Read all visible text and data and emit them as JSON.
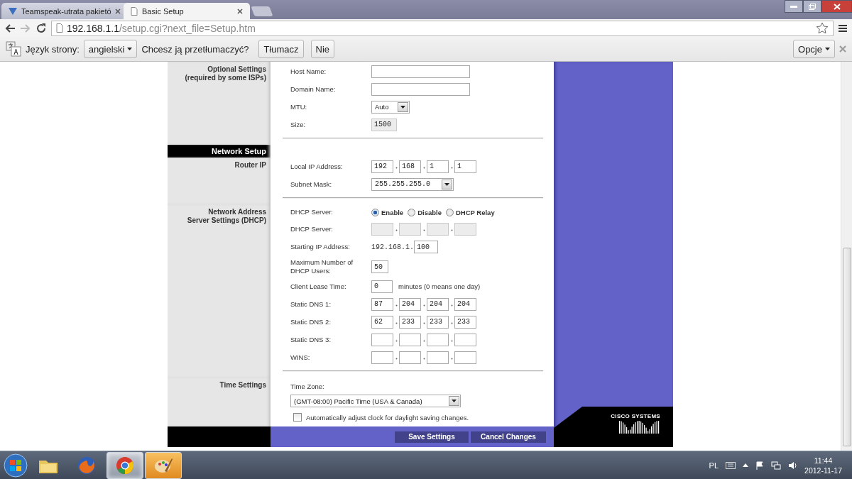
{
  "browser": {
    "tabs": [
      {
        "title": "Teamspeak-utrata pakietó",
        "selected": false
      },
      {
        "title": "Basic Setup",
        "selected": true
      }
    ],
    "address": {
      "host": "192.168.1.1",
      "path": "/setup.cgi?next_file=Setup.htm"
    }
  },
  "translate_bar": {
    "label": "Język strony:",
    "language": "angielski",
    "question": "Chcesz ją przetłumaczyć?",
    "buttons": [
      "Tłumacz",
      "Nie"
    ],
    "options": "Opcje"
  },
  "page": {
    "sections": [
      {
        "kind": "form",
        "heading": [
          "Optional Settings",
          "(required by some ISPs)"
        ],
        "rows": [
          {
            "kind": "text",
            "label": "Host Name:"
          },
          {
            "kind": "text",
            "label": "Domain Name:"
          },
          {
            "kind": "select",
            "label": "MTU:",
            "value": "Auto"
          },
          {
            "kind": "number",
            "label": "Size:",
            "value": "1500",
            "disabled": true
          }
        ]
      },
      {
        "kind": "header",
        "heading": [
          "Network Setup"
        ]
      },
      {
        "kind": "form",
        "heading": [
          "Router IP"
        ],
        "rows": [
          {
            "kind": "ip",
            "label": "Local IP Address:",
            "octets": [
              "192",
              "168",
              "1",
              "1"
            ],
            "disabled": false
          },
          {
            "kind": "select",
            "label": "Subnet Mask:",
            "value": "255.255.255.0"
          }
        ]
      },
      {
        "kind": "form",
        "heading": [
          "Network Address",
          "Server Settings (DHCP)"
        ],
        "rows": [
          {
            "kind": "radio",
            "label": "DHCP Server:",
            "options": [
              {
                "label": "Enable",
                "selected": true
              },
              {
                "label": "Disable",
                "selected": false
              },
              {
                "label": "DHCP Relay",
                "selected": false
              }
            ]
          },
          {
            "kind": "ip",
            "label": "DHCP Server:",
            "disabled": true
          },
          {
            "kind": "prefixed",
            "label": "Starting IP Address:",
            "prefix": "192.168.1.",
            "value": "100"
          },
          {
            "kind": "number",
            "label": "Maximum Number of DHCP Users:",
            "value": "50",
            "disabled": false
          },
          {
            "kind": "number",
            "label": "Client Lease Time:",
            "value": "0",
            "note": "minutes (0 means one day)",
            "disabled": false
          },
          {
            "kind": "ip",
            "label": "Static DNS 1:",
            "octets": [
              "87",
              "204",
              "204",
              "204"
            ],
            "disabled": false
          },
          {
            "kind": "ip",
            "label": "Static DNS 2:",
            "octets": [
              "62",
              "233",
              "233",
              "233"
            ],
            "disabled": false
          },
          {
            "kind": "ip",
            "label": "Static DNS 3:",
            "disabled": false
          },
          {
            "kind": "ip",
            "label": "WINS:",
            "disabled": false
          }
        ]
      },
      {
        "kind": "form",
        "heading": [
          "Time Settings"
        ],
        "rows": [
          {
            "kind": "caption",
            "label": "Time Zone:"
          },
          {
            "kind": "wide_select",
            "value": "(GMT-08:00) Pacific Time (USA & Canada)"
          },
          {
            "kind": "checkbox",
            "label": "Automatically adjust clock for daylight saving changes.",
            "checked": false
          }
        ]
      }
    ],
    "buttons": [
      "Save Settings",
      "Cancel Changes"
    ],
    "logo": "CISCO SYSTEMS"
  },
  "taskbar": {
    "apps": [
      {
        "kind": "folder",
        "selected": false,
        "flashing": false
      },
      {
        "kind": "firefox",
        "selected": false,
        "flashing": false
      },
      {
        "kind": "chrome",
        "selected": true,
        "flashing": false
      },
      {
        "kind": "paint",
        "selected": false,
        "flashing": true
      }
    ],
    "language": "PL",
    "time": "11:44",
    "date": "2012-11-17"
  }
}
